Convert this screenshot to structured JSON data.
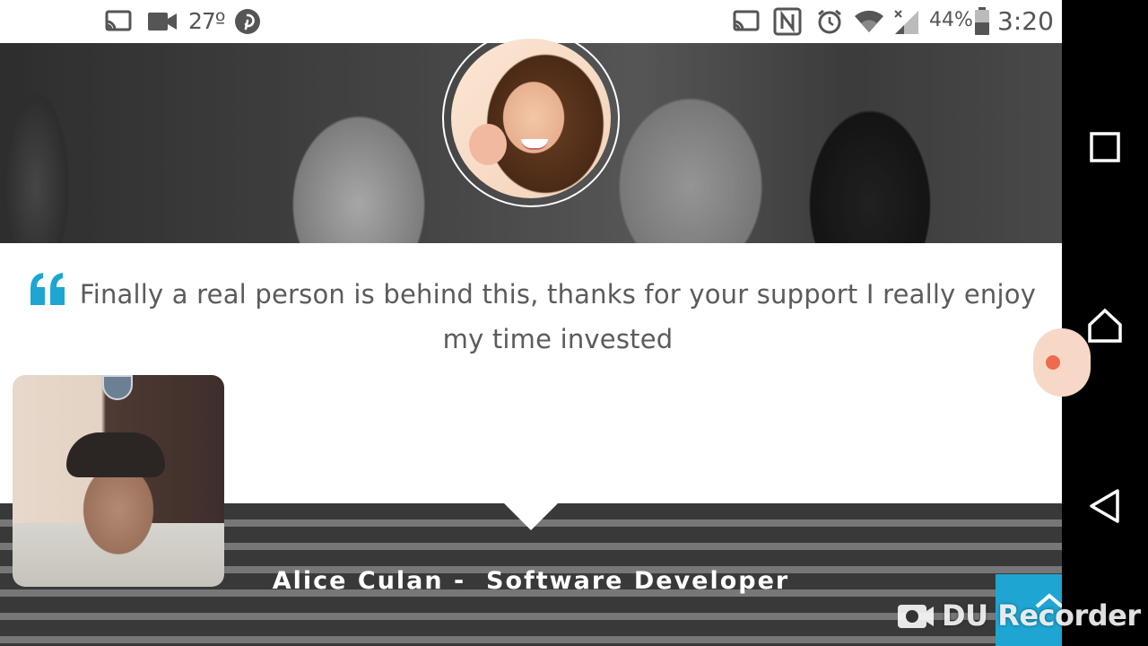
{
  "status_bar": {
    "temperature": "27º",
    "battery": "44%",
    "time": "3:20",
    "icons_left": [
      "cast-icon",
      "video-camera-icon",
      "pinterest-icon"
    ],
    "icons_right": [
      "cast-icon",
      "nfc-icon",
      "alarm-icon",
      "wifi-icon",
      "signal-icon",
      "battery-icon"
    ]
  },
  "testimonial": {
    "quote": "Finally a real person is behind this, thanks for your support I really enjoy my time invested",
    "author": "Alice Culan -  Software Developer"
  },
  "watermark": {
    "text": "DU Recorder"
  },
  "colors": {
    "accent": "#1ea5d2",
    "quote_text": "#5b5b5b",
    "card_bg": "#ffffff"
  },
  "nav_bar": {
    "buttons": [
      "recents-button",
      "home-button",
      "back-button"
    ]
  }
}
